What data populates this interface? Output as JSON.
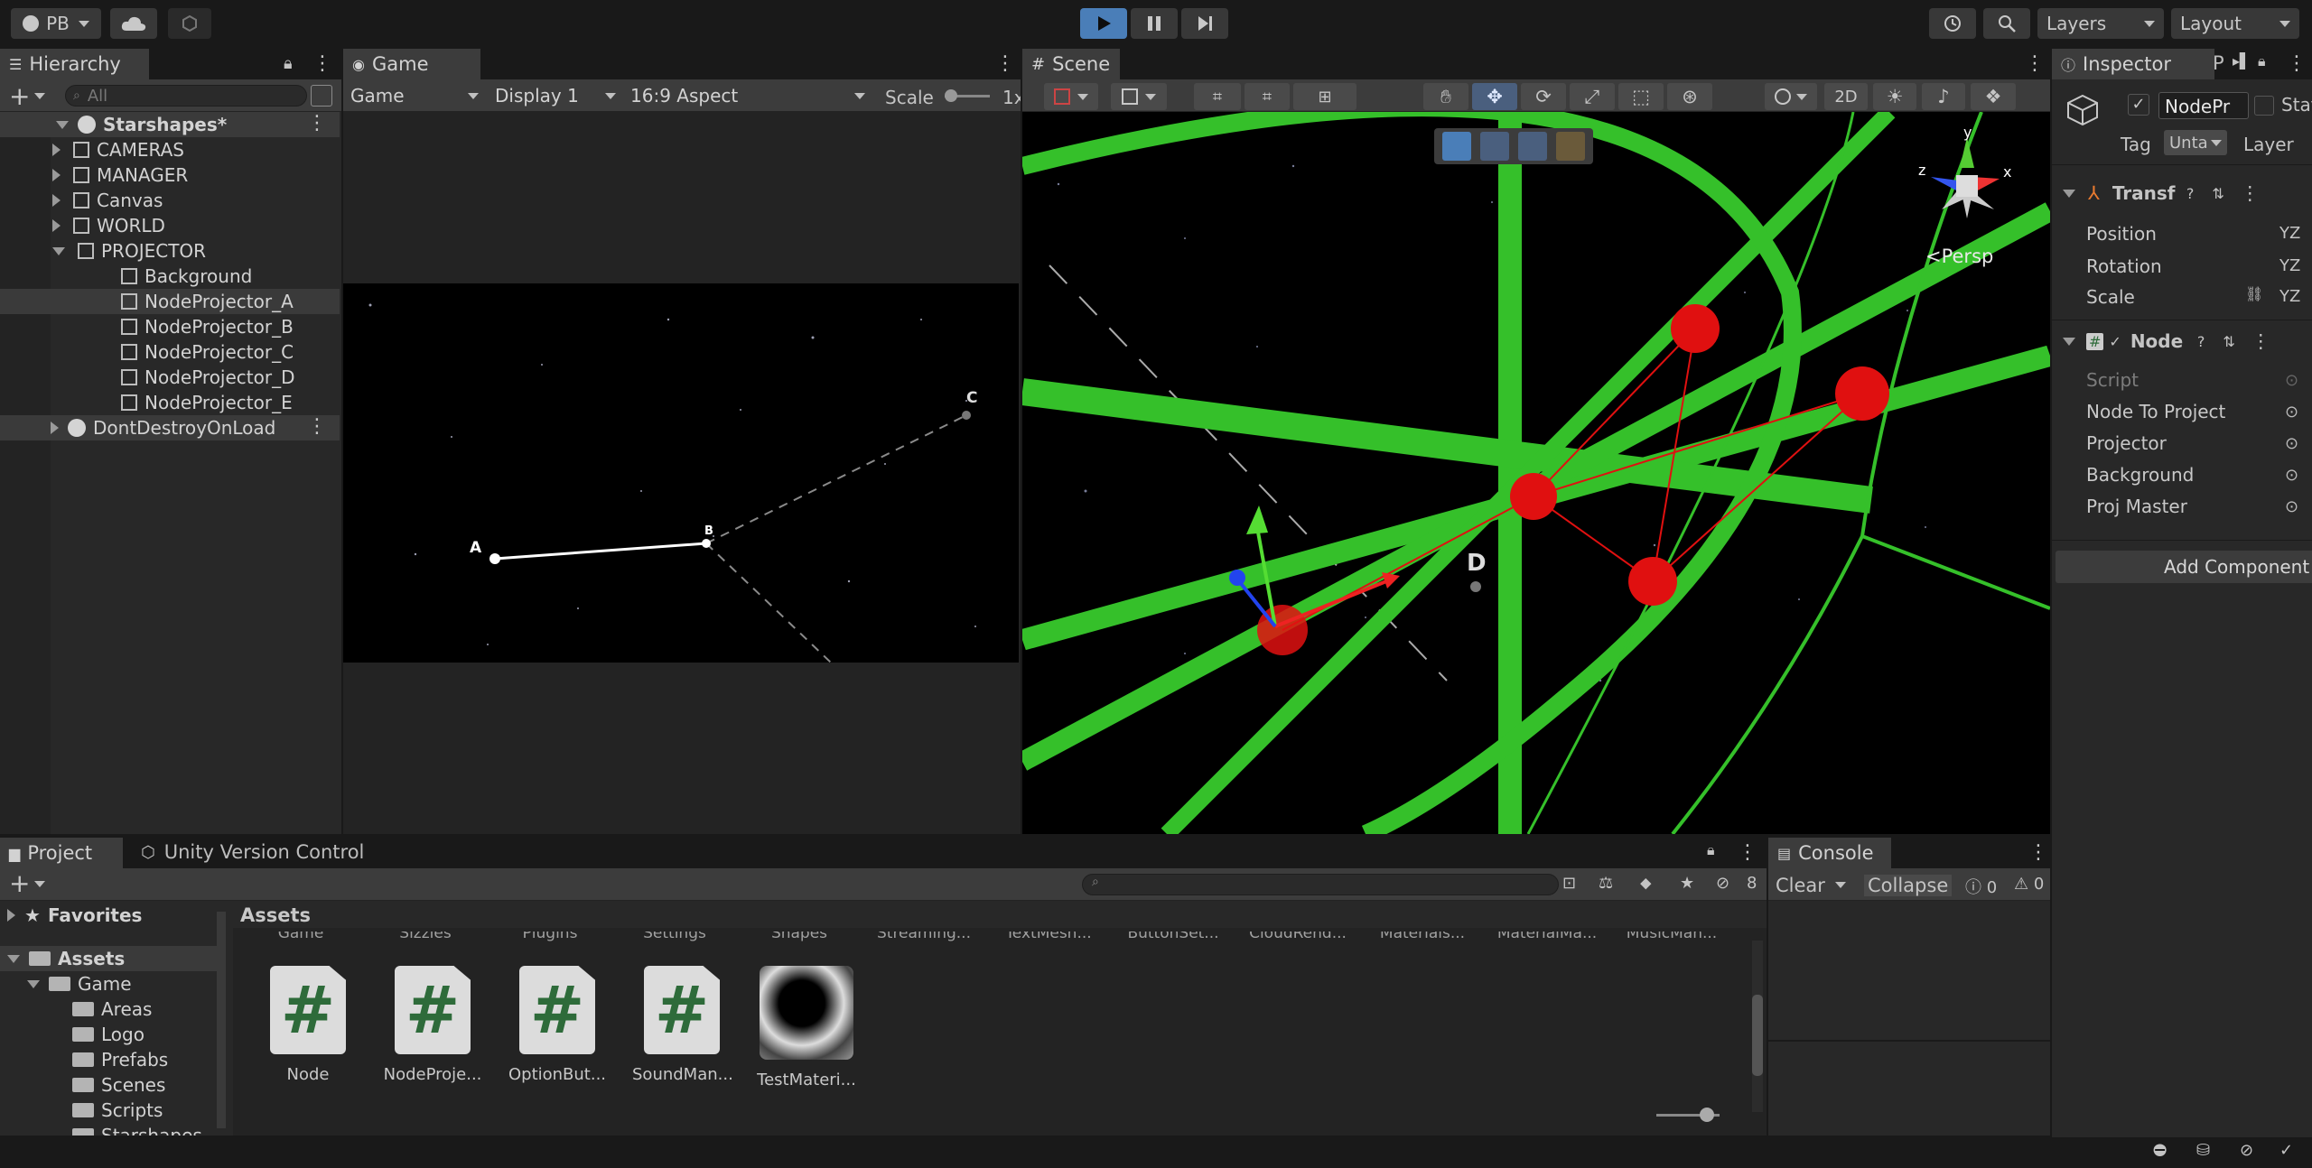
{
  "topbar": {
    "account": "PB",
    "layers": "Layers",
    "layout": "Layout"
  },
  "hierarchy": {
    "tab": "Hierarchy",
    "search_placeholder": "All",
    "scene": "Starshapes*",
    "items": [
      {
        "label": "CAMERAS",
        "indent": 1,
        "expand": "right"
      },
      {
        "label": "MANAGER",
        "indent": 1,
        "expand": "right"
      },
      {
        "label": "Canvas",
        "indent": 1,
        "expand": "right"
      },
      {
        "label": "WORLD",
        "indent": 1,
        "expand": "right"
      },
      {
        "label": "PROJECTOR",
        "indent": 1,
        "expand": "down"
      },
      {
        "label": "Background",
        "indent": 2,
        "expand": "none"
      },
      {
        "label": "NodeProjector_A",
        "indent": 2,
        "expand": "none",
        "selected": true
      },
      {
        "label": "NodeProjector_B",
        "indent": 2,
        "expand": "none"
      },
      {
        "label": "NodeProjector_C",
        "indent": 2,
        "expand": "none"
      },
      {
        "label": "NodeProjector_D",
        "indent": 2,
        "expand": "none"
      },
      {
        "label": "NodeProjector_E",
        "indent": 2,
        "expand": "none"
      }
    ],
    "dontdestroy": "DontDestroyOnLoad"
  },
  "game": {
    "tab": "Game",
    "mode": "Game",
    "display": "Display 1",
    "aspect": "16:9 Aspect",
    "scale_label": "Scale",
    "scale_value": "1x",
    "nodes": {
      "a": "A",
      "b": "B",
      "c": "C"
    }
  },
  "scene": {
    "tab": "Scene",
    "btn_2d": "2D",
    "persp": "<Persp",
    "node_d": "D",
    "gizmo": {
      "y": "y",
      "x": "x",
      "z": "z"
    }
  },
  "inspector": {
    "tab": "Inspector",
    "tab2": "P",
    "object_name": "NodePr",
    "static": "Stati",
    "tag_label": "Tag",
    "tag_value": "Unta",
    "layer_label": "Layer",
    "transform": "Transf",
    "position": "Position",
    "rotation": "Rotation",
    "scale": "Scale",
    "xyz": "YZ",
    "component": "Node I",
    "fields": [
      "Script",
      "Node To Project",
      "Projector",
      "Background",
      "Proj Master"
    ],
    "add_component": "Add Component"
  },
  "project": {
    "tab": "Project",
    "tab2": "Unity Version Control",
    "hidden_count": "8",
    "favorites": "Favorites",
    "assets": "Assets",
    "tree": [
      "Game",
      "Areas",
      "Logo",
      "Prefabs",
      "Scenes",
      "Scripts",
      "Starshapes"
    ],
    "breadcrumb": "Assets",
    "top_row": [
      "Game",
      "Sizzles",
      "Plugins",
      "Settings",
      "Shapes",
      "Streaming...",
      "TextMesh...",
      "ButtonSet...",
      "CloudRend...",
      "Materials...",
      "MaterialMa...",
      "MusicMan..."
    ],
    "assets_list": [
      {
        "label": "Node",
        "kind": "script"
      },
      {
        "label": "NodeProje...",
        "kind": "script"
      },
      {
        "label": "OptionBut...",
        "kind": "script"
      },
      {
        "label": "SoundMan...",
        "kind": "script"
      },
      {
        "label": "TestMateri...",
        "kind": "material"
      }
    ]
  },
  "console": {
    "tab": "Console",
    "clear": "Clear",
    "collapse": "Collapse",
    "errors": "0",
    "warnings": "0"
  },
  "colors": {
    "play_active": "#4a7eb8",
    "green": "#35c02a",
    "red": "#e01010",
    "panel": "#282828"
  }
}
